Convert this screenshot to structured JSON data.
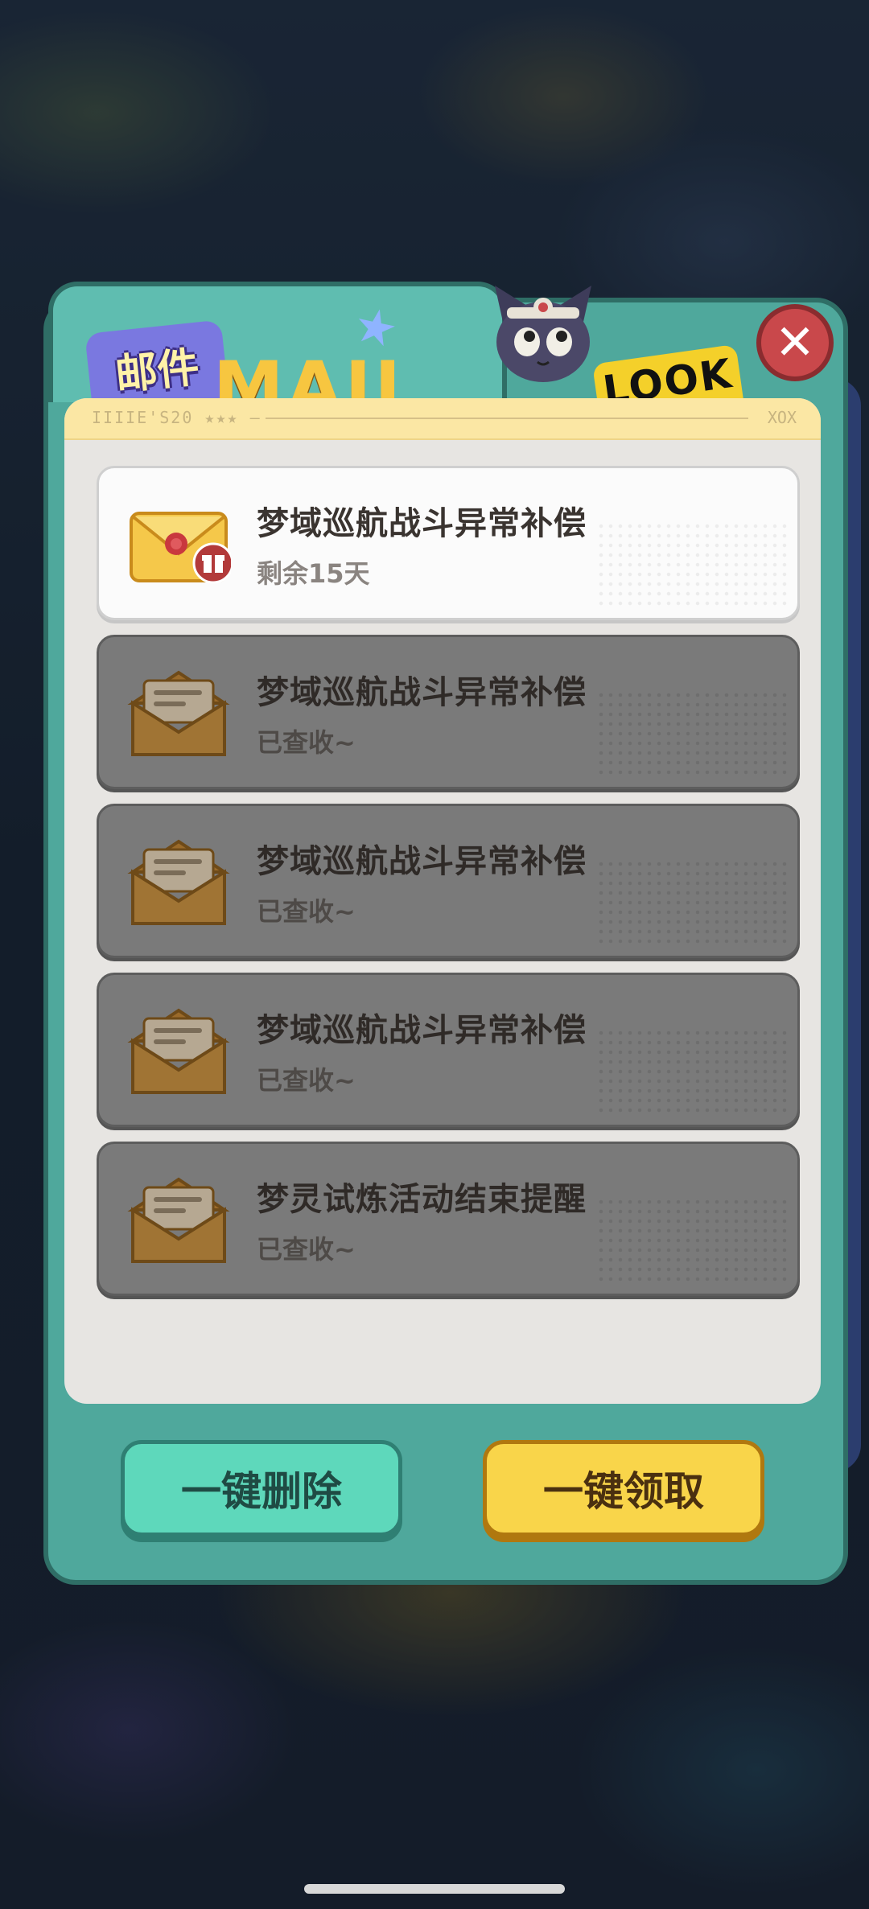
{
  "dialog": {
    "title": "邮件",
    "title_decor": "MAIL",
    "header_sticker": "LOOK",
    "strip_text": "IIIIE'S20 ★★★ —  —",
    "strip_end": "XOX",
    "close_label": "✕"
  },
  "mails": [
    {
      "title": "梦域巡航战斗异常补偿",
      "status": "剩余15天",
      "state": "unread",
      "has_gift": true
    },
    {
      "title": "梦域巡航战斗异常补偿",
      "status": "已查收~",
      "state": "read",
      "has_gift": false
    },
    {
      "title": "梦域巡航战斗异常补偿",
      "status": "已查收~",
      "state": "read",
      "has_gift": false
    },
    {
      "title": "梦域巡航战斗异常补偿",
      "status": "已查收~",
      "state": "read",
      "has_gift": false
    },
    {
      "title": "梦灵试炼活动结束提醒",
      "status": "已查收~",
      "state": "read",
      "has_gift": false
    }
  ],
  "buttons": {
    "delete_all": "一键删除",
    "claim_all": "一键领取"
  },
  "colors": {
    "frame": "#4fa89c",
    "delete_button": "#5ed8bb",
    "claim_button": "#f9d54a",
    "close_button": "#c9484b"
  }
}
